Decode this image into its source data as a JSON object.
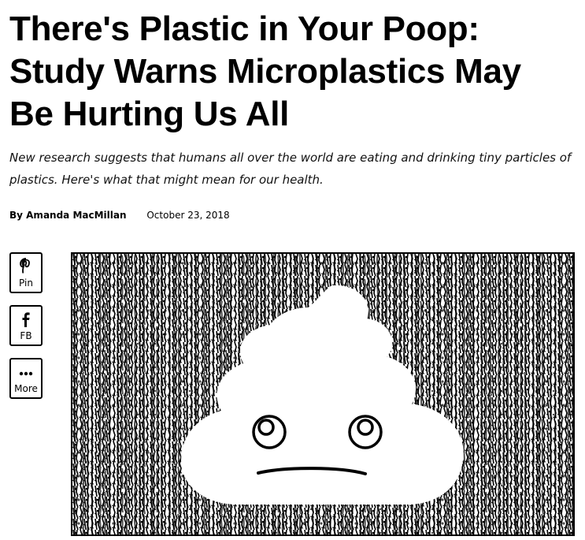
{
  "article": {
    "headline_lines": [
      "There's Plastic in Your Poop:",
      "Study Warns Microplastics May",
      "Be Hurting Us All"
    ],
    "dek_lines": [
      "New research suggests that humans all over the world are eating and drinking tiny particles of",
      "plastics. Here's what that might mean for our health."
    ],
    "byline": {
      "author": "By Amanda MacMillan",
      "date": "October 23, 2018"
    }
  },
  "share": {
    "pinterest": {
      "label": "Pin",
      "icon": "pinterest-icon"
    },
    "facebook": {
      "label": "FB",
      "icon": "facebook-icon"
    },
    "more": {
      "label": "More",
      "icon": "more-dots-icon"
    }
  },
  "hero": {
    "icon": "poop-emoji-illustration"
  }
}
